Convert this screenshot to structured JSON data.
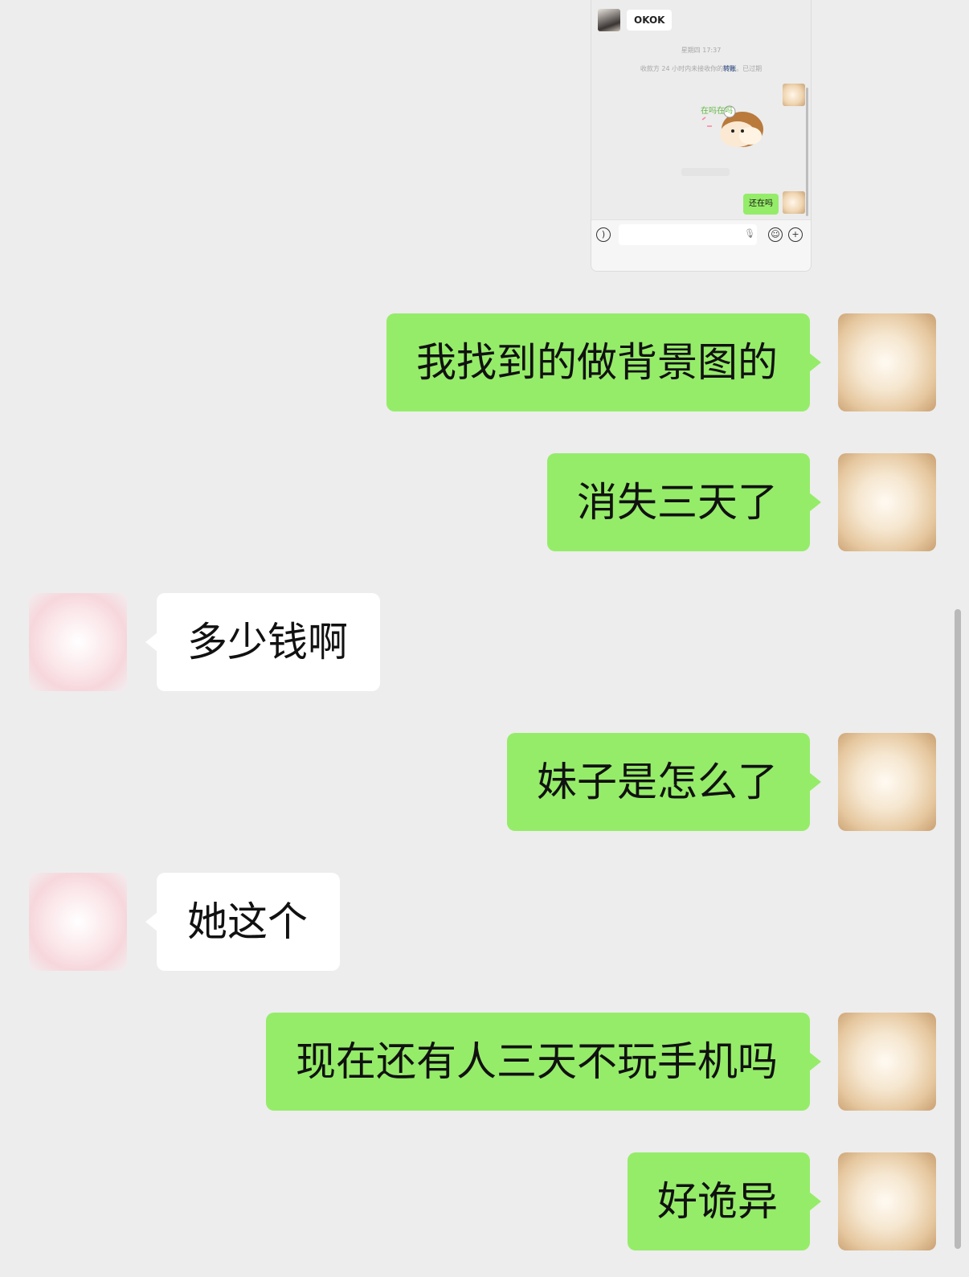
{
  "embedded_screenshot": {
    "reply_text": "OKOK",
    "timestamp": "星期四 17:37",
    "system_notice_prefix": "收款方 24 小时内未接收你的",
    "system_notice_link": "转账",
    "system_notice_suffix": "。已过期",
    "sticker_text": "在吗在吗",
    "last_message": "还在吗"
  },
  "messages": [
    {
      "sender": "me",
      "text": "我找到的做背景图的"
    },
    {
      "sender": "me",
      "text": "消失三天了"
    },
    {
      "sender": "other",
      "text": "多少钱啊"
    },
    {
      "sender": "me",
      "text": "妹子是怎么了"
    },
    {
      "sender": "other",
      "text": "她这个"
    },
    {
      "sender": "me",
      "text": "现在还有人三天不玩手机吗"
    },
    {
      "sender": "me",
      "text": "好诡异"
    }
  ],
  "colors": {
    "background": "#ededed",
    "my_bubble": "#95ec69",
    "other_bubble": "#ffffff",
    "link": "#576b95"
  }
}
